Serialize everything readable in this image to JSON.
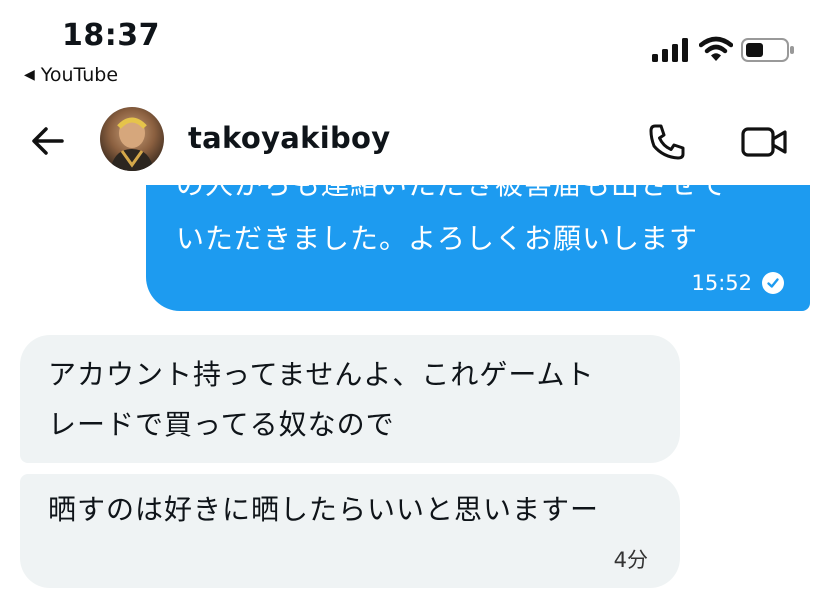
{
  "status_bar": {
    "time": "18:37",
    "back_app_label": "YouTube"
  },
  "header": {
    "username": "takoyakiboy"
  },
  "messages": [
    {
      "direction": "outgoing",
      "lines": [
        "の人からも連絡いただき被害届も出させて",
        "いただきました。よろしくお願いします"
      ],
      "time": "15:52"
    },
    {
      "direction": "incoming",
      "lines": [
        "アカウント持ってませんよ、これゲームト",
        "レードで買ってる奴なので"
      ]
    },
    {
      "direction": "incoming",
      "lines": [
        "晒すのは好きに晒したらいいと思いますー"
      ],
      "time": "4分"
    }
  ],
  "colors": {
    "outgoing_bubble": "#1d9bf0",
    "incoming_bubble": "#eff3f4",
    "text": "#0f1419"
  },
  "icons": [
    "back-arrow-icon",
    "phone-icon",
    "video-camera-icon",
    "signal-icon",
    "wifi-icon",
    "battery-icon",
    "read-check-icon"
  ]
}
